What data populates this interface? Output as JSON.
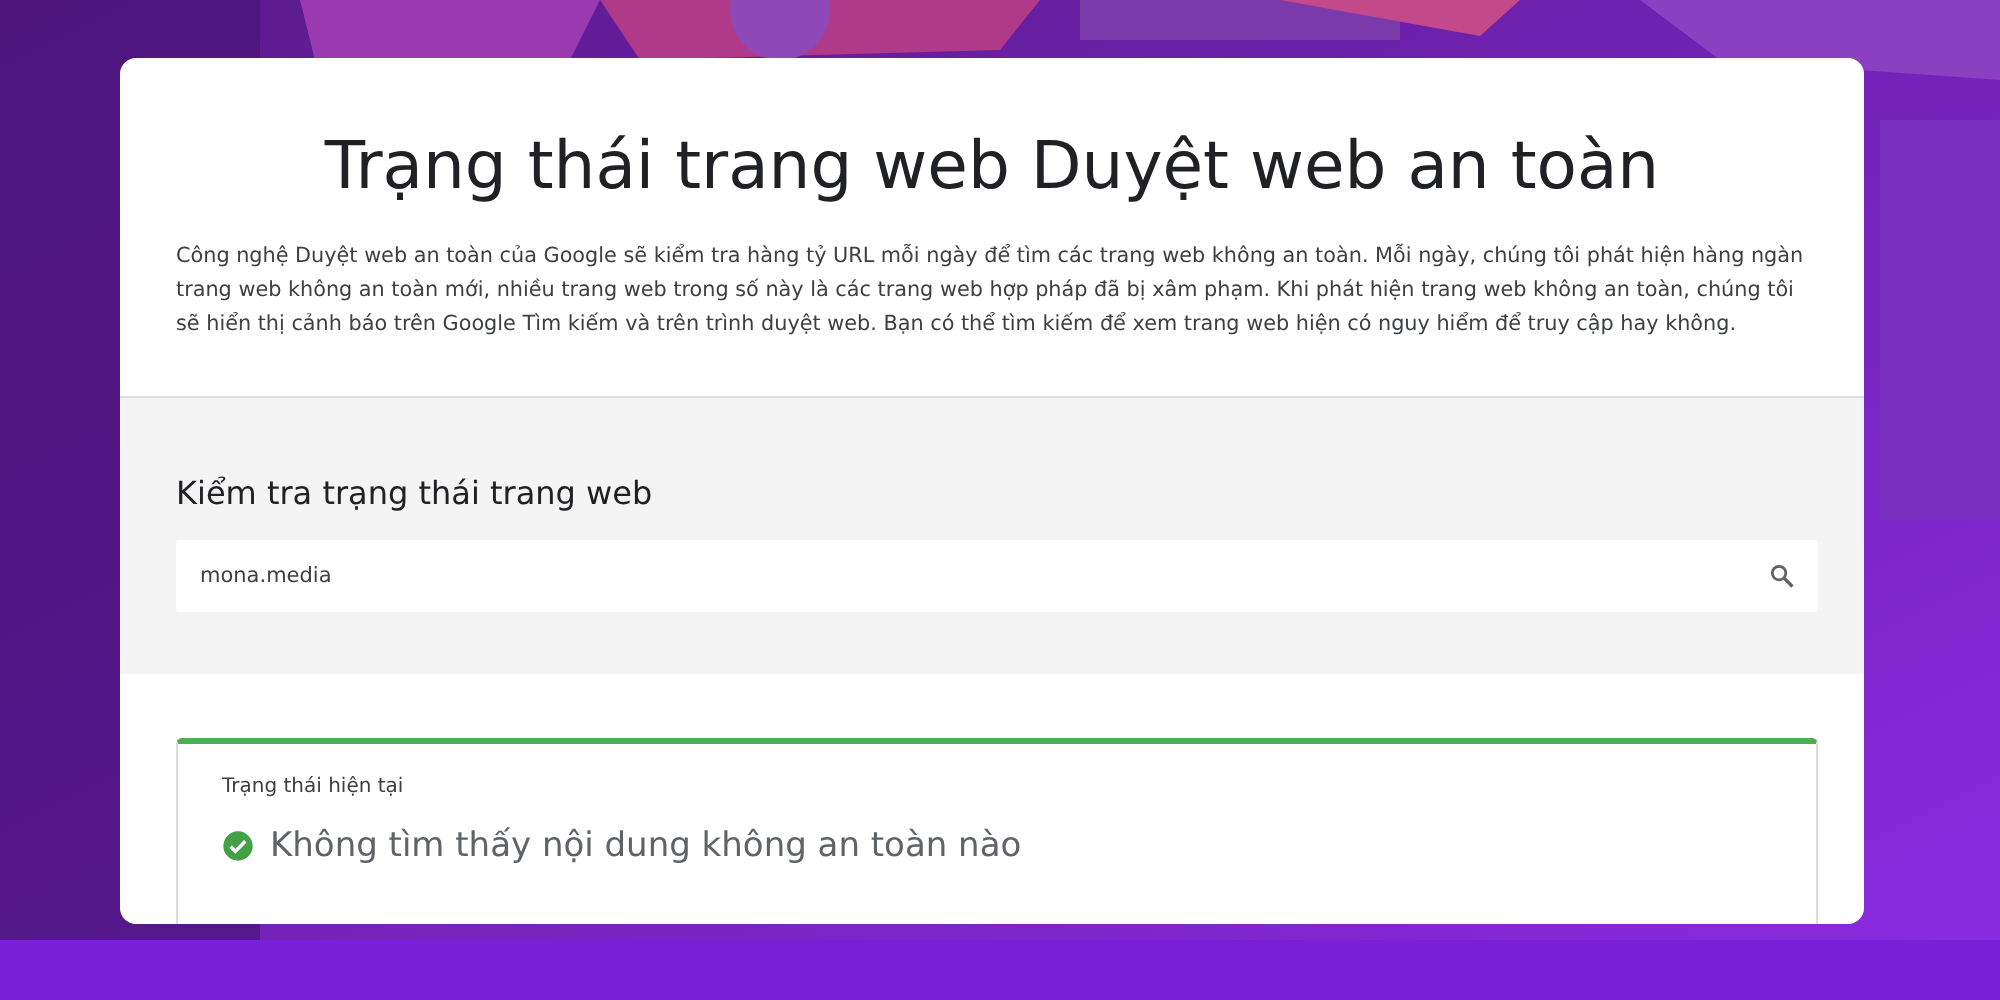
{
  "page": {
    "title": "Trạng thái trang web Duyệt web an toàn",
    "description": "Công nghệ Duyệt web an toàn của Google sẽ kiểm tra hàng tỷ URL mỗi ngày để tìm các trang web không an toàn. Mỗi ngày, chúng tôi phát hiện hàng ngàn trang web không an toàn mới, nhiều trang web trong số này là các trang web hợp pháp đã bị xâm phạm. Khi phát hiện trang web không an toàn, chúng tôi sẽ hiển thị cảnh báo trên Google Tìm kiếm và trên trình duyệt web. Bạn có thể tìm kiếm để xem trang web hiện có nguy hiểm để truy cập hay không."
  },
  "check": {
    "heading": "Kiểm tra trạng thái trang web",
    "search": {
      "value": "mona.media"
    }
  },
  "result": {
    "label": "Trạng thái hiện tại",
    "status": "Không tìm thấy nội dung không an toàn nào",
    "safe": true
  }
}
